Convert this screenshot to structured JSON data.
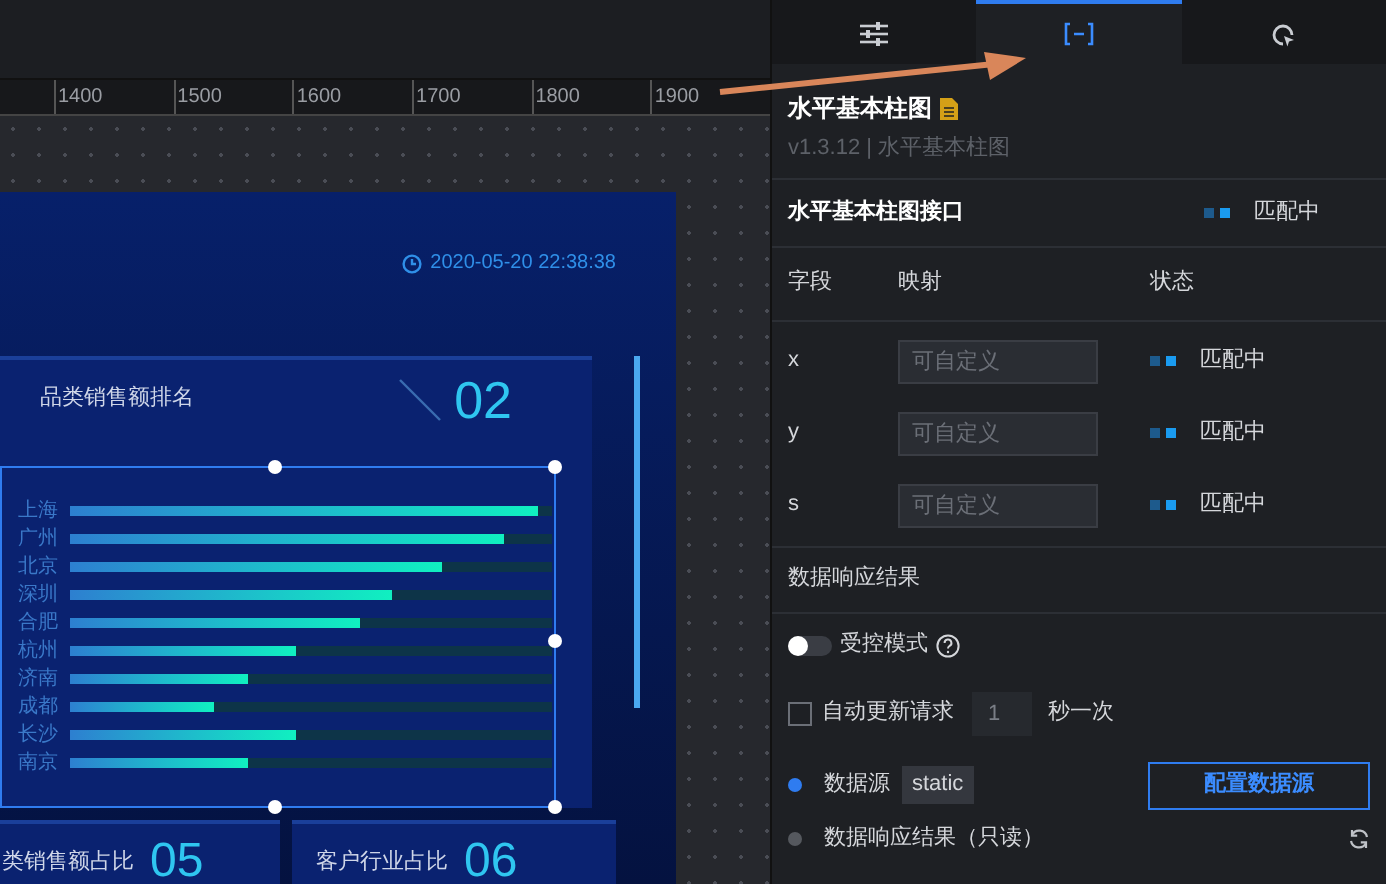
{
  "ruler": {
    "ticks": [
      "1400",
      "1500",
      "1600",
      "1700",
      "1800",
      "1900"
    ]
  },
  "dashboard": {
    "datetime": "2020-05-20 22:38:38",
    "main_card": {
      "title": "品类销售额排名",
      "number": "02",
      "bars": [
        {
          "label": "上海",
          "level": 0.97
        },
        {
          "label": "广州",
          "level": 0.9
        },
        {
          "label": "北京",
          "level": 0.77
        },
        {
          "label": "深圳",
          "level": 0.67
        },
        {
          "label": "合肥",
          "level": 0.6
        },
        {
          "label": "杭州",
          "level": 0.47
        },
        {
          "label": "济南",
          "level": 0.37
        },
        {
          "label": "成都",
          "level": 0.3
        },
        {
          "label": "长沙",
          "level": 0.47
        },
        {
          "label": "南京",
          "level": 0.37
        }
      ]
    },
    "small_cards": [
      {
        "title": "类销售额占比",
        "number": "05"
      },
      {
        "title": "客户行业占比",
        "number": "06"
      }
    ]
  },
  "panel": {
    "tabs": [
      {
        "kind": "style",
        "selected": false
      },
      {
        "kind": "data",
        "selected": true
      },
      {
        "kind": "interaction",
        "selected": false
      }
    ],
    "component": {
      "title": "水平基本柱图",
      "version": "v1.3.12 | 水平基本柱图"
    },
    "interface": {
      "name": "水平基本柱图接口",
      "status": "匹配中"
    },
    "fields": {
      "headers": [
        "字段",
        "映射",
        "状态"
      ],
      "rows": [
        {
          "name": "x",
          "placeholder": "可自定义",
          "status": "匹配中"
        },
        {
          "name": "y",
          "placeholder": "可自定义",
          "status": "匹配中"
        },
        {
          "name": "s",
          "placeholder": "可自定义",
          "status": "匹配中"
        }
      ]
    },
    "response": {
      "title": "数据响应结果",
      "controlled": {
        "label": "受控模式",
        "on": false
      },
      "auto_update": {
        "label": "自动更新请求",
        "checked": false,
        "value": "1",
        "unit": "秒一次"
      },
      "source": {
        "label": "数据源",
        "value": "static",
        "button": "配置数据源"
      },
      "result": {
        "label": "数据响应结果（只读）"
      }
    }
  }
}
